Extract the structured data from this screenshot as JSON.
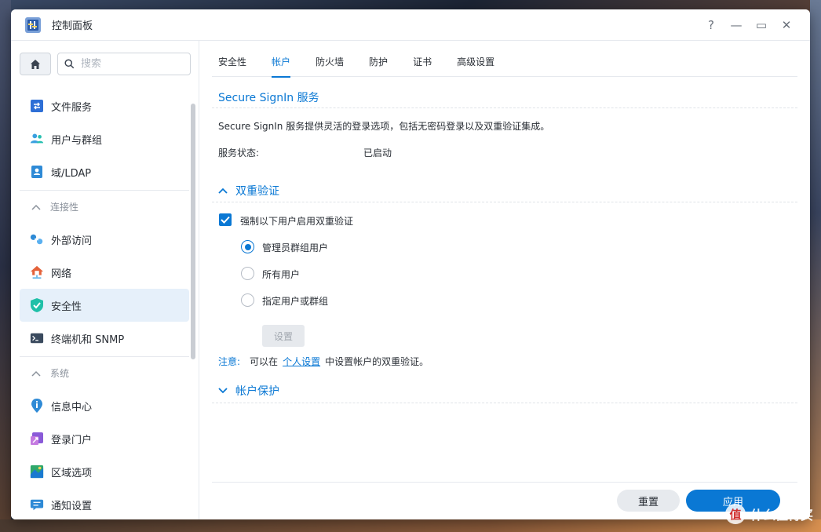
{
  "window": {
    "title": "控制面板",
    "controls": {
      "help": "?",
      "minimize": "—",
      "maximize": "▭",
      "close": "✕"
    }
  },
  "sidebar": {
    "search_placeholder": "搜索",
    "items_top": [
      {
        "label": "文件服务",
        "icon": "file-services-icon"
      },
      {
        "label": "用户与群组",
        "icon": "users-groups-icon"
      },
      {
        "label": "域/LDAP",
        "icon": "domain-ldap-icon"
      }
    ],
    "group_connectivity": {
      "label": "连接性",
      "items": [
        {
          "label": "外部访问",
          "icon": "external-access-icon"
        },
        {
          "label": "网络",
          "icon": "network-icon"
        },
        {
          "label": "安全性",
          "icon": "security-shield-icon",
          "active": true
        },
        {
          "label": "终端机和 SNMP",
          "icon": "terminal-icon"
        }
      ]
    },
    "group_system": {
      "label": "系统",
      "items": [
        {
          "label": "信息中心",
          "icon": "info-center-icon"
        },
        {
          "label": "登录门户",
          "icon": "login-portal-icon"
        },
        {
          "label": "区域选项",
          "icon": "regional-options-icon"
        },
        {
          "label": "通知设置",
          "icon": "notification-icon"
        }
      ]
    }
  },
  "tabs": [
    "安全性",
    "帐户",
    "防火墙",
    "防护",
    "证书",
    "高级设置"
  ],
  "active_tab": "帐户",
  "secure_signin": {
    "title": "Secure SignIn 服务",
    "description": "Secure SignIn 服务提供灵活的登录选项，包括无密码登录以及双重验证集成。",
    "status_label": "服务状态:",
    "status_value": "已启动"
  },
  "two_factor": {
    "title": "双重验证",
    "enforce_label": "强制以下用户启用双重验证",
    "enforce_checked": true,
    "options": [
      "管理员群组用户",
      "所有用户",
      "指定用户或群组"
    ],
    "selected_option": "管理员群组用户",
    "settings_button": "设置",
    "note_label": "注意:",
    "note_prefix": "可以在",
    "note_link": "个人设置",
    "note_suffix": "中设置帐户的双重验证。"
  },
  "account_protection": {
    "title": "帐户保护"
  },
  "footer": {
    "reset": "重置",
    "apply": "应用"
  },
  "watermark": {
    "badge": "值",
    "text": "什么值得买"
  }
}
